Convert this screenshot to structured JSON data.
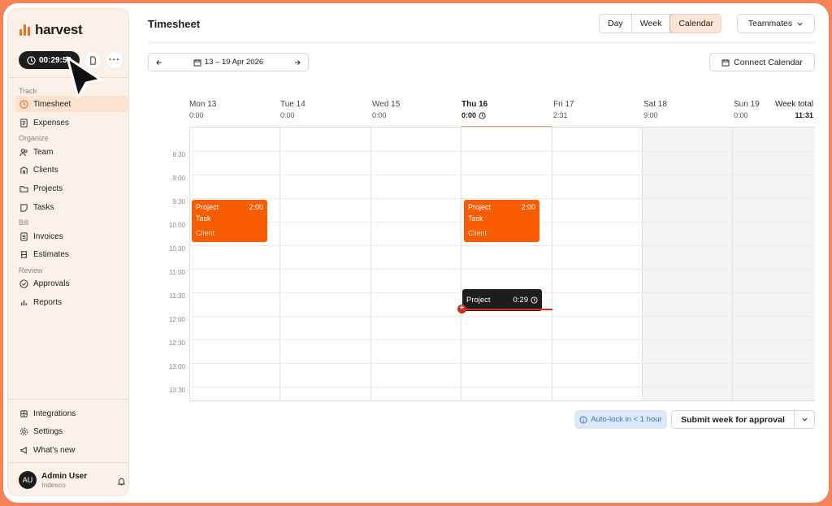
{
  "app": {
    "logo_text": "harvest"
  },
  "sidebar": {
    "timer_value": "00:29:56",
    "sections": {
      "track": "Track",
      "organize": "Organize",
      "bill": "Bill",
      "review": "Review"
    },
    "items": [
      {
        "label": "Timesheet",
        "icon": "clock-icon",
        "active": true
      },
      {
        "label": "Expenses",
        "icon": "receipt-icon"
      },
      {
        "label": "Team",
        "icon": "team-icon"
      },
      {
        "label": "Clients",
        "icon": "building-icon"
      },
      {
        "label": "Projects",
        "icon": "folder-icon"
      },
      {
        "label": "Tasks",
        "icon": "task-icon"
      },
      {
        "label": "Invoices",
        "icon": "invoice-icon"
      },
      {
        "label": "Estimates",
        "icon": "estimate-icon"
      },
      {
        "label": "Approvals",
        "icon": "check-circle-icon"
      },
      {
        "label": "Reports",
        "icon": "bar-chart-icon"
      }
    ],
    "bottom_items": [
      {
        "label": "Integrations",
        "icon": "plug-icon"
      },
      {
        "label": "Settings",
        "icon": "gear-icon"
      },
      {
        "label": "What's new",
        "icon": "megaphone-icon"
      }
    ],
    "user": {
      "initials": "AU",
      "name": "Admin User",
      "org": "Iridesco"
    }
  },
  "header": {
    "title": "Timesheet",
    "views": [
      "Day",
      "Week",
      "Calendar"
    ],
    "selected_view": "Calendar",
    "teammates_label": "Teammates",
    "date_range": "13 – 19 Apr 2026",
    "connect_calendar": "Connect Calendar"
  },
  "calendar": {
    "days": [
      {
        "day": "Mon 13",
        "hours": "0:00"
      },
      {
        "day": "Tue 14",
        "hours": "0:00"
      },
      {
        "day": "Wed 15",
        "hours": "0:00"
      },
      {
        "day": "Thu 16",
        "hours": "0:00",
        "today": true
      },
      {
        "day": "Fri 17",
        "hours": "2:31"
      },
      {
        "day": "Sat 18",
        "hours": "9:00"
      },
      {
        "day": "Sun 19",
        "hours": "0:00"
      }
    ],
    "week_total_label": "Week total",
    "week_total": "11:31",
    "times": [
      "8:30",
      "9:00",
      "9:30",
      "10:00",
      "10:30",
      "11:00",
      "11:30",
      "12:00",
      "12:30",
      "13:00",
      "13:30"
    ],
    "events": [
      {
        "project": "Project",
        "duration": "2:00",
        "task": "Task",
        "client": "Client"
      },
      {
        "project": "Project",
        "duration": "2:00",
        "task": "Task",
        "client": "Client"
      }
    ],
    "running": {
      "project": "Project",
      "duration": "0:29"
    }
  },
  "footer": {
    "autolock": "Auto-lock in < 1 hour",
    "submit": "Submit week for approval"
  },
  "colors": {
    "accent": "#fa5d00",
    "now_line": "#d62a1c"
  }
}
